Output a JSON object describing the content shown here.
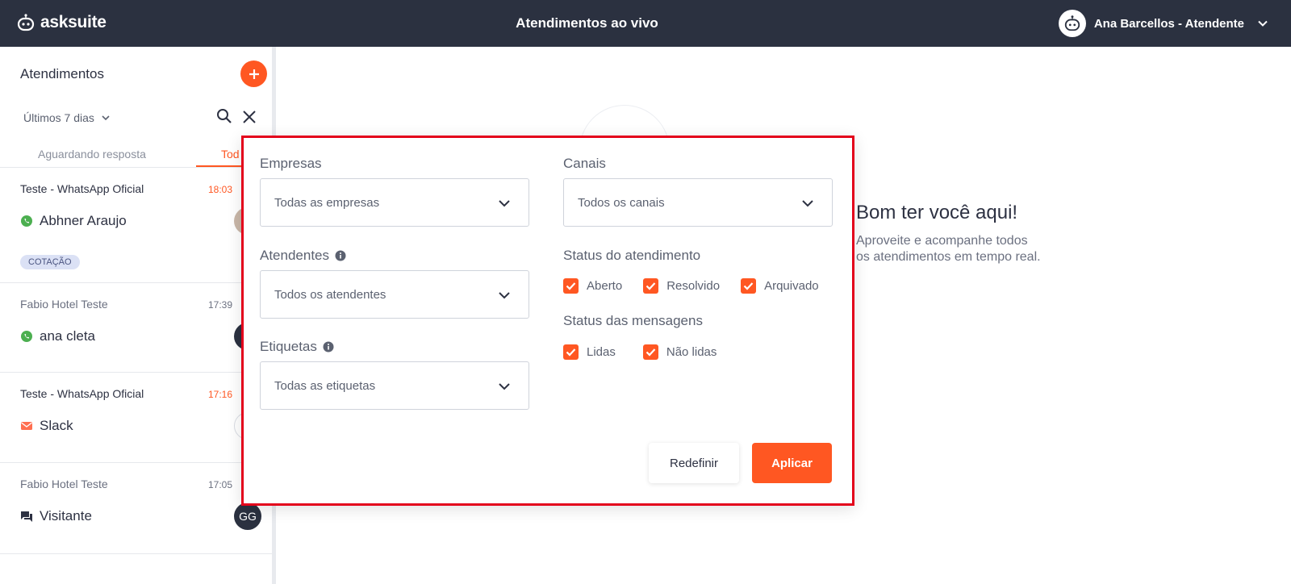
{
  "app": {
    "brand": "asksuite",
    "page_title": "Atendimentos ao vivo"
  },
  "user": {
    "name": "Ana Barcellos - Atendente"
  },
  "left": {
    "title": "Atendimentos",
    "period": "Últimos 7 dias",
    "tabs": [
      "Aguardando resposta",
      "Tod"
    ]
  },
  "conversations": [
    {
      "company": "Teste - WhatsApp Oficial",
      "time": "18:03",
      "time_alert": true,
      "contact": "Abhner Araujo",
      "channel": "whatsapp-icon",
      "tag": "COTAÇÃO"
    },
    {
      "company": "Fabio Hotel Teste",
      "time": "17:39",
      "time_alert": false,
      "contact": "ana cleta",
      "channel": "whatsapp-icon"
    },
    {
      "company": "Teste - WhatsApp Oficial",
      "time": "17:16",
      "time_alert": true,
      "contact": "Slack",
      "channel": "email-icon"
    },
    {
      "company": "Fabio Hotel Teste",
      "time": "17:05",
      "time_alert": false,
      "contact": "Visitante",
      "channel": "chat-icon",
      "avatar_initials": "GG"
    }
  ],
  "welcome": {
    "title": "Bom ter você aqui!",
    "subtitle_line1": "Aproveite e acompanhe todos",
    "subtitle_line2": "os atendimentos em tempo real."
  },
  "filters": {
    "empresas": {
      "label": "Empresas",
      "value": "Todas as empresas"
    },
    "canais": {
      "label": "Canais",
      "value": "Todos os canais"
    },
    "atendentes": {
      "label": "Atendentes",
      "value": "Todos os atendentes"
    },
    "etiquetas": {
      "label": "Etiquetas",
      "value": "Todas as etiquetas"
    },
    "status_atendimento": {
      "label": "Status do atendimento",
      "options": [
        {
          "label": "Aberto",
          "checked": true
        },
        {
          "label": "Resolvido",
          "checked": true
        },
        {
          "label": "Arquivado",
          "checked": true
        }
      ]
    },
    "status_mensagens": {
      "label": "Status das mensagens",
      "options": [
        {
          "label": "Lidas",
          "checked": true
        },
        {
          "label": "Não lidas",
          "checked": true
        }
      ]
    },
    "reset_label": "Redefinir",
    "apply_label": "Aplicar"
  },
  "colors": {
    "accent": "#ff5722",
    "topbar": "#2b3140",
    "highlight_border": "#e3001b"
  }
}
